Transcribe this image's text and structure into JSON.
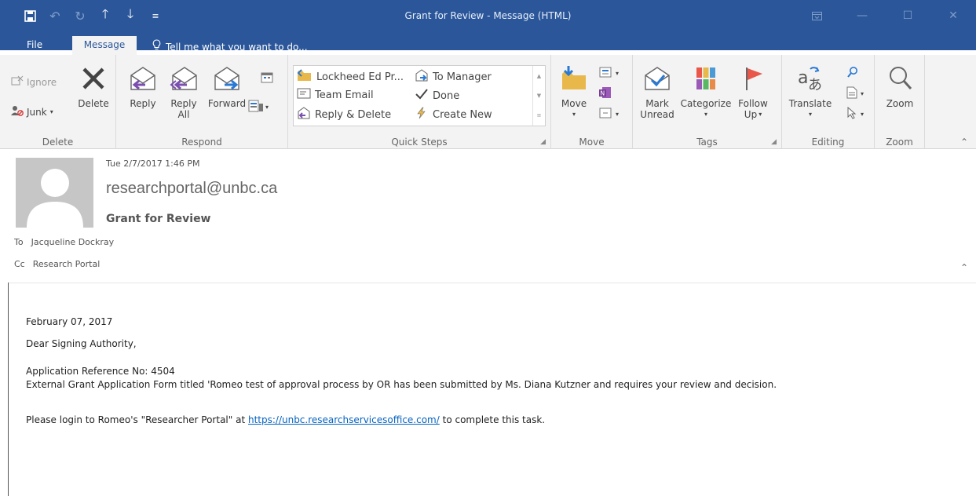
{
  "window": {
    "title": "Grant for Review  -  Message (HTML)"
  },
  "tabs": {
    "file": "File",
    "message": "Message",
    "tell_me": "Tell me what you want to do..."
  },
  "ribbon": {
    "delete_group": {
      "label": "Delete",
      "ignore": "Ignore",
      "junk": "Junk",
      "delete": "Delete"
    },
    "respond_group": {
      "label": "Respond",
      "reply": "Reply",
      "reply_all_line1": "Reply",
      "reply_all_line2": "All",
      "forward": "Forward"
    },
    "quick_steps_group": {
      "label": "Quick Steps",
      "items": [
        "Lockheed Ed Pr...",
        "Team Email",
        "Reply & Delete",
        "To Manager",
        "Done",
        "Create New"
      ]
    },
    "move_group": {
      "label": "Move",
      "move": "Move"
    },
    "tags_group": {
      "label": "Tags",
      "mark_unread_line1": "Mark",
      "mark_unread_line2": "Unread",
      "categorize": "Categorize",
      "follow_up_line1": "Follow",
      "follow_up_line2": "Up"
    },
    "editing_group": {
      "label": "Editing",
      "translate": "Translate"
    },
    "zoom_group": {
      "label": "Zoom",
      "zoom": "Zoom"
    }
  },
  "message": {
    "datetime": "Tue 2/7/2017 1:46 PM",
    "sender": "researchportal@unbc.ca",
    "subject": "Grant for Review",
    "to_label": "To",
    "to": "Jacqueline Dockray",
    "cc_label": "Cc",
    "cc": "Research Portal",
    "body": {
      "date": "February 07, 2017",
      "greeting": "Dear Signing Authority,",
      "reference": "Application Reference No: 4504",
      "description": "External Grant Application Form titled 'Romeo test of approval process by OR has been submitted by Ms. Diana Kutzner and requires your review and decision.",
      "login_prefix": "Please login to Romeo's \"Researcher Portal\" at ",
      "login_link": "https://unbc.researchservicesoffice.com/",
      "login_suffix": " to complete this task."
    }
  },
  "colors": {
    "accent": "#2b579a",
    "ribbon_bg": "#f3f3f3",
    "link": "#0563c1",
    "flag_red": "#e8574a",
    "arrow_purple": "#7b4fb0",
    "arrow_blue": "#2a7ad5",
    "folder_yellow": "#e8b84a"
  }
}
